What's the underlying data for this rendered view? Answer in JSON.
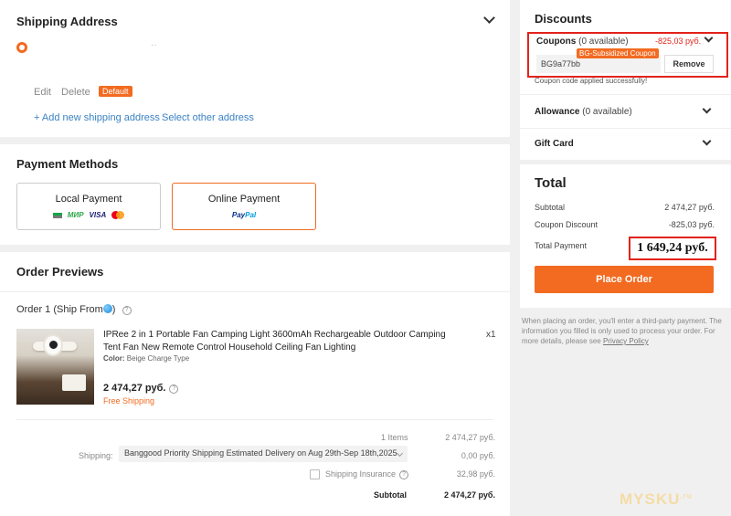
{
  "shipping": {
    "title": "Shipping Address",
    "address_text": "··",
    "edit": "Edit",
    "delete": "Delete",
    "default_badge": "Default",
    "add_new": "+ Add new shipping address",
    "select_other": "Select other address"
  },
  "payment": {
    "title": "Payment Methods",
    "local": {
      "label": "Local Payment",
      "logos": [
        "MИР",
        "VISA"
      ]
    },
    "online": {
      "label": "Online Payment",
      "logo_pay": "Pay",
      "logo_pal": "Pal"
    },
    "selected": "Online Payment"
  },
  "order": {
    "title": "Order Previews",
    "order_label": "Order 1",
    "ship_from": "(Ship From",
    "ship_from_close": ")",
    "product_name": "IPRee 2 in 1 Portable Fan Camping Light 3600mAh Rechargeable Outdoor Camping Tent Fan New Remote Control Household Ceiling Fan Lighting",
    "color_label": "Color:",
    "color_value": "Beige Charge Type",
    "qty": "x1",
    "price": "2 474,27 руб.",
    "free_shipping": "Free Shipping",
    "items_label": "1 Items",
    "items_value": "2 474,27 руб.",
    "shipping_label": "Shipping:",
    "shipping_method": "Banggood Priority Shipping Estimated Delivery on Aug 29th-Sep 18th,2025",
    "shipping_value": "0,00 руб.",
    "insurance_label": "Shipping Insurance",
    "insurance_value": "32,98 руб.",
    "subtotal_label": "Subtotal",
    "subtotal_value": "2 474,27 руб."
  },
  "discounts": {
    "title": "Discounts",
    "coupons_label": "Coupons",
    "coupons_available": "(0 available)",
    "coupons_discount": "-825,03 руб.",
    "coupon_tag": "BG-Subsidized Coupon",
    "coupon_code": "BG9a77bb",
    "remove": "Remove",
    "applied_msg": "Coupon code applied successfully!",
    "allowance_label": "Allowance",
    "allowance_available": "(0 available)",
    "gift_card": "Gift Card"
  },
  "total": {
    "title": "Total",
    "subtotal_label": "Subtotal",
    "subtotal_value": "2 474,27 руб.",
    "coupon_label": "Coupon Discount",
    "coupon_value": "-825,03 руб.",
    "total_label": "Total Payment",
    "total_value": "1 649,24 руб.",
    "place_order": "Place Order"
  },
  "note": {
    "text": "When placing an order, you'll enter a third-party payment. The information you filled is only used to process your order. For more details, please see",
    "link": "Privacy Policy"
  },
  "watermark": {
    "text": "MYSKU",
    "suffix": ".ru"
  },
  "colors": {
    "accent": "#f26b21",
    "highlight": "#e2231a",
    "link": "#3b82c4"
  }
}
